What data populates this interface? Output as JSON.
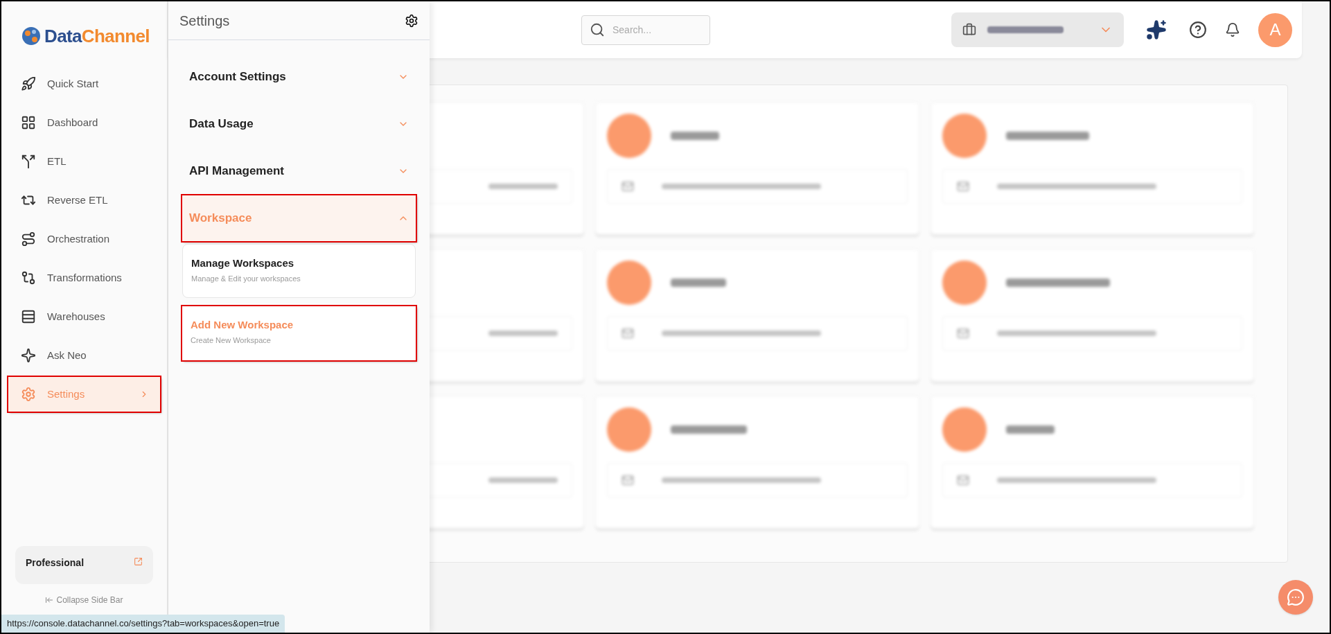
{
  "brand": {
    "first": "Data",
    "second": "Channel"
  },
  "nav": [
    {
      "label": "Quick Start",
      "selected": false,
      "annotated": false
    },
    {
      "label": "Dashboard",
      "selected": false,
      "annotated": false
    },
    {
      "label": "ETL",
      "selected": false,
      "annotated": false
    },
    {
      "label": "Reverse ETL",
      "selected": false,
      "annotated": false
    },
    {
      "label": "Orchestration",
      "selected": false,
      "annotated": false
    },
    {
      "label": "Transformations",
      "selected": false,
      "annotated": false
    },
    {
      "label": "Warehouses",
      "selected": false,
      "annotated": false
    },
    {
      "label": "Ask Neo",
      "selected": false,
      "annotated": false
    },
    {
      "label": "Settings",
      "selected": true,
      "annotated": true
    }
  ],
  "plan": {
    "name": "Professional"
  },
  "collapse": "Collapse Side Bar",
  "settings_panel": {
    "title": "Settings",
    "sections": [
      {
        "label": "Account Settings",
        "expanded": false,
        "annotated": false
      },
      {
        "label": "Data Usage",
        "expanded": false,
        "annotated": false
      },
      {
        "label": "API Management",
        "expanded": false,
        "annotated": false
      },
      {
        "label": "Workspace",
        "expanded": true,
        "annotated": true
      }
    ],
    "items": [
      {
        "title": "Manage Workspaces",
        "subtitle": "Manage & Edit your workspaces",
        "selected": false,
        "annotated": false
      },
      {
        "title": "Add New Workspace",
        "subtitle": "Create New Workspace",
        "selected": true,
        "annotated": true
      }
    ]
  },
  "search": {
    "placeholder": "Search..."
  },
  "user": {
    "initial": "A"
  },
  "member_cards": [
    {
      "kind": "partial"
    },
    {
      "kind": "blurred"
    },
    {
      "kind": "blurred"
    },
    {
      "kind": "partial"
    },
    {
      "kind": "blurred"
    },
    {
      "kind": "blurred"
    },
    {
      "kind": "partial"
    },
    {
      "kind": "blurred"
    },
    {
      "kind": "blurred"
    }
  ],
  "status_url": "https://console.datachannel.co/settings?tab=workspaces&open=true"
}
